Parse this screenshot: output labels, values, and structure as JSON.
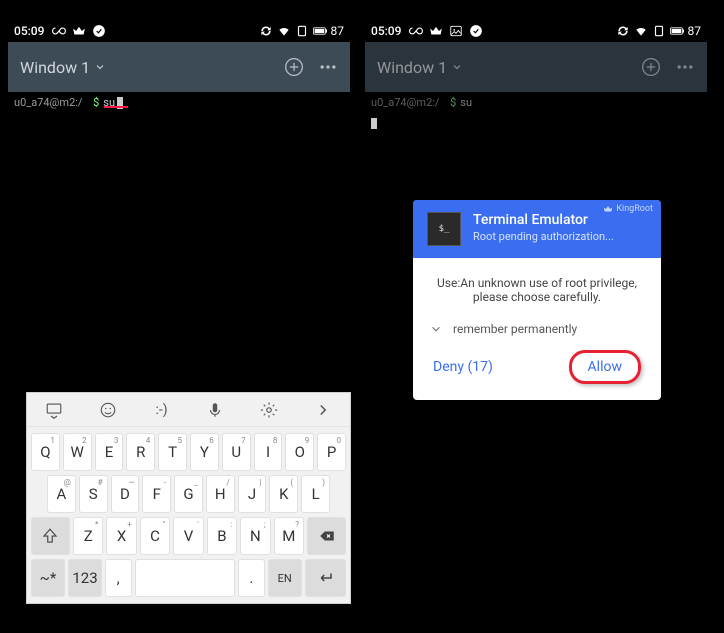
{
  "status": {
    "time": "05:09",
    "battery": "87"
  },
  "header": {
    "tab": "Window 1"
  },
  "terminal": {
    "prompt": "u0_a74@m2:/",
    "symbol": "$",
    "command": "su"
  },
  "keyboard": {
    "toolbar": {
      "smile_text": ":-)"
    },
    "row1": [
      {
        "k": "Q",
        "s": "1"
      },
      {
        "k": "W",
        "s": "2"
      },
      {
        "k": "E",
        "s": "3"
      },
      {
        "k": "R",
        "s": "4"
      },
      {
        "k": "T",
        "s": "5"
      },
      {
        "k": "Y",
        "s": "6"
      },
      {
        "k": "U",
        "s": "7"
      },
      {
        "k": "I",
        "s": "8"
      },
      {
        "k": "O",
        "s": "9"
      },
      {
        "k": "P",
        "s": "0"
      }
    ],
    "row2": [
      {
        "k": "A",
        "s": "@"
      },
      {
        "k": "S",
        "s": "#"
      },
      {
        "k": "D",
        "s": "~"
      },
      {
        "k": "F",
        "s": "-"
      },
      {
        "k": "G",
        "s": "_"
      },
      {
        "k": "H",
        "s": "/"
      },
      {
        "k": "J",
        "s": "|"
      },
      {
        "k": "K",
        "s": "("
      },
      {
        "k": "L",
        "s": ")"
      }
    ],
    "row3": [
      {
        "k": "Z",
        "s": "*"
      },
      {
        "k": "X",
        "s": "+"
      },
      {
        "k": "C",
        "s": "\""
      },
      {
        "k": "V",
        "s": "'"
      },
      {
        "k": "B",
        "s": ":"
      },
      {
        "k": "N",
        "s": ";"
      },
      {
        "k": "M",
        "s": "?"
      }
    ],
    "row4": {
      "sym": "~*",
      "num": "123",
      "comma": ",",
      "dot": ".",
      "lang": "EN"
    }
  },
  "dialog": {
    "brand": "KingRoot",
    "icon_text": "$_",
    "title": "Terminal Emulator",
    "subtitle": "Root pending authorization...",
    "body": "Use:An unknown use of root privilege, please choose carefully.",
    "remember": "remember permanently",
    "deny": "Deny (17)",
    "allow": "Allow"
  }
}
